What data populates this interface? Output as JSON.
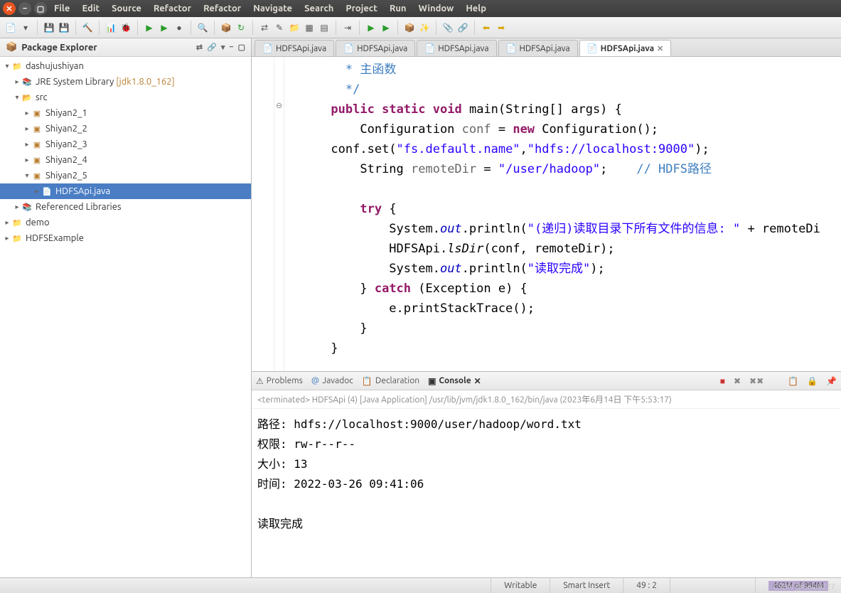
{
  "menu": [
    "File",
    "Edit",
    "Source",
    "Refactor",
    "Refactor",
    "Navigate",
    "Search",
    "Project",
    "Run",
    "Window",
    "Help"
  ],
  "package_explorer": {
    "title": "Package Explorer",
    "tree": {
      "project": "dashujushiyan",
      "jre": "JRE System Library",
      "jre_ver": "[jdk1.8.0_162]",
      "src": "src",
      "packages": [
        "Shiyan2_1",
        "Shiyan2_2",
        "Shiyan2_3",
        "Shiyan2_4",
        "Shiyan2_5"
      ],
      "active_file": "HDFSApi.java",
      "ref_lib": "Referenced Libraries",
      "other_projects": [
        "demo",
        "HDFSExample"
      ]
    }
  },
  "editor_tabs": [
    "HDFSApi.java",
    "HDFSApi.java",
    "HDFSApi.java",
    "HDFSApi.java",
    "HDFSApi.java"
  ],
  "code": {
    "comment1": " * 主函数",
    "comment2": " */",
    "l_public": "public",
    "l_static": "static",
    "l_void": "void",
    "main_sig": " main(String[] args) {",
    "conf_decl_a": "Configuration ",
    "conf_decl_b": "conf",
    "conf_decl_c": " = ",
    "l_new": "new",
    "conf_decl_d": " Configuration();",
    "conf_set_a": "conf.set(",
    "conf_set_s1": "\"fs.default.name\"",
    "conf_set_s2": "\"hdfs://localhost:9000\"",
    "conf_set_b": ");",
    "remote_a": "String ",
    "remote_b": "remoteDir",
    "remote_c": " = ",
    "remote_s": "\"/user/hadoop\"",
    "remote_d": ";    ",
    "remote_comment": "// HDFS路径",
    "l_try": "try",
    "try_brace": " {",
    "sys_a": "System.",
    "sys_out": "out",
    "sys_b": ".println(",
    "print1_s": "\"(递归)读取目录下所有文件的信息: \"",
    "print1_tail": " + remoteDi",
    "lsdir_a": "HDFSApi.",
    "lsdir_m": "lsDir",
    "lsdir_b": "(conf, remoteDir);",
    "print2_s": "\"读取完成\"",
    "print2_tail": ");",
    "catch_brace": "} ",
    "l_catch": "catch",
    "catch_sig": " (Exception e) {",
    "stack": "e.printStackTrace();",
    "close1": "}",
    "close2": "}"
  },
  "bottom": {
    "tabs": [
      "Problems",
      "Javadoc",
      "Declaration",
      "Console"
    ],
    "console_header": "<terminated> HDFSApi (4) [Java Application] /usr/lib/jvm/jdk1.8.0_162/bin/java (2023年6月14日 下午5:53:17)",
    "output": "路径: hdfs://localhost:9000/user/hadoop/word.txt\n权限: rw-r--r--\n大小: 13\n时间: 2022-03-26 09:41:06\n\n读取完成"
  },
  "status": {
    "writable": "Writable",
    "insert": "Smart Insert",
    "pos": "49 : 2",
    "heap": "462M of 994M"
  },
  "watermark": "CSDN @Gala8227"
}
